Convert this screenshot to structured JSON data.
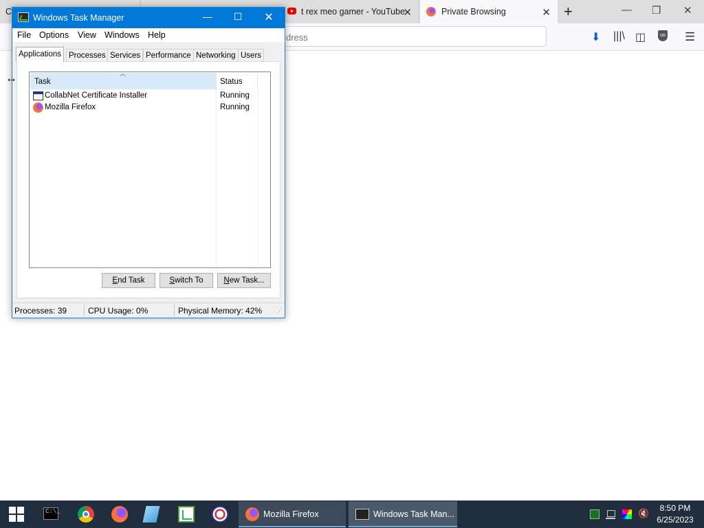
{
  "browser": {
    "tabs": [
      {
        "title": "C"
      },
      {
        "title": "t rex meo gamer - YouTube"
      },
      {
        "title": "Private Browsing"
      }
    ],
    "url_placeholder": "dress",
    "new_tab": "+",
    "close_glyph": "✕"
  },
  "taskmanager": {
    "title": "Windows Task Manager",
    "menu": [
      "File",
      "Options",
      "View",
      "Windows",
      "Help"
    ],
    "tabs": [
      "Applications",
      "Processes",
      "Services",
      "Performance",
      "Networking",
      "Users"
    ],
    "active_tab": "Applications",
    "columns": {
      "task": "Task",
      "status": "Status"
    },
    "rows": [
      {
        "task": "CollabNet Certificate Installer",
        "status": "Running"
      },
      {
        "task": "Mozilla Firefox",
        "status": "Running"
      }
    ],
    "buttons": {
      "end_task_ul": "E",
      "end_task_rest": "nd Task",
      "switch_to_ul": "S",
      "switch_to_rest": "witch To",
      "new_task_ul": "N",
      "new_task_rest": "ew Task..."
    },
    "status": {
      "processes": "Processes: 39",
      "cpu": "CPU Usage: 0%",
      "memory": "Physical Memory: 42%"
    }
  },
  "taskbar": {
    "apps": [
      {
        "label": "Mozilla Firefox"
      },
      {
        "label": "Windows Task Man..."
      }
    ],
    "clock_time": "8:50 PM",
    "clock_date": "6/25/2023"
  },
  "colors": {
    "titlebar": "#0078d7",
    "taskbar": "#1f2d3d",
    "selected_header": "#d9ebf9"
  }
}
